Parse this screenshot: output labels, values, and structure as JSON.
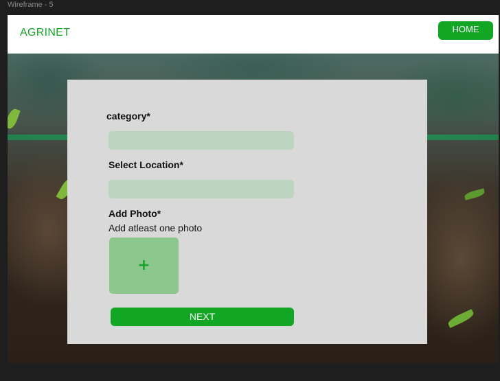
{
  "frame": {
    "label": "Wireframe - 5"
  },
  "header": {
    "brand": "AGRINET",
    "home_label": "HOME"
  },
  "form": {
    "category_label": "category*",
    "category_value": "",
    "location_label": "Select Location*",
    "location_value": "",
    "photo_label": "Add Photo*",
    "photo_hint": "Add atleast one photo",
    "add_photo_glyph": "+",
    "next_label": "NEXT"
  },
  "colors": {
    "brand_green": "#17a829",
    "button_green": "#11a623",
    "field_fill": "#bdd5bf",
    "photo_fill": "#8cc78d",
    "card_bg": "#d9d9d9"
  },
  "icons": {
    "add_photo": "plus-icon"
  }
}
